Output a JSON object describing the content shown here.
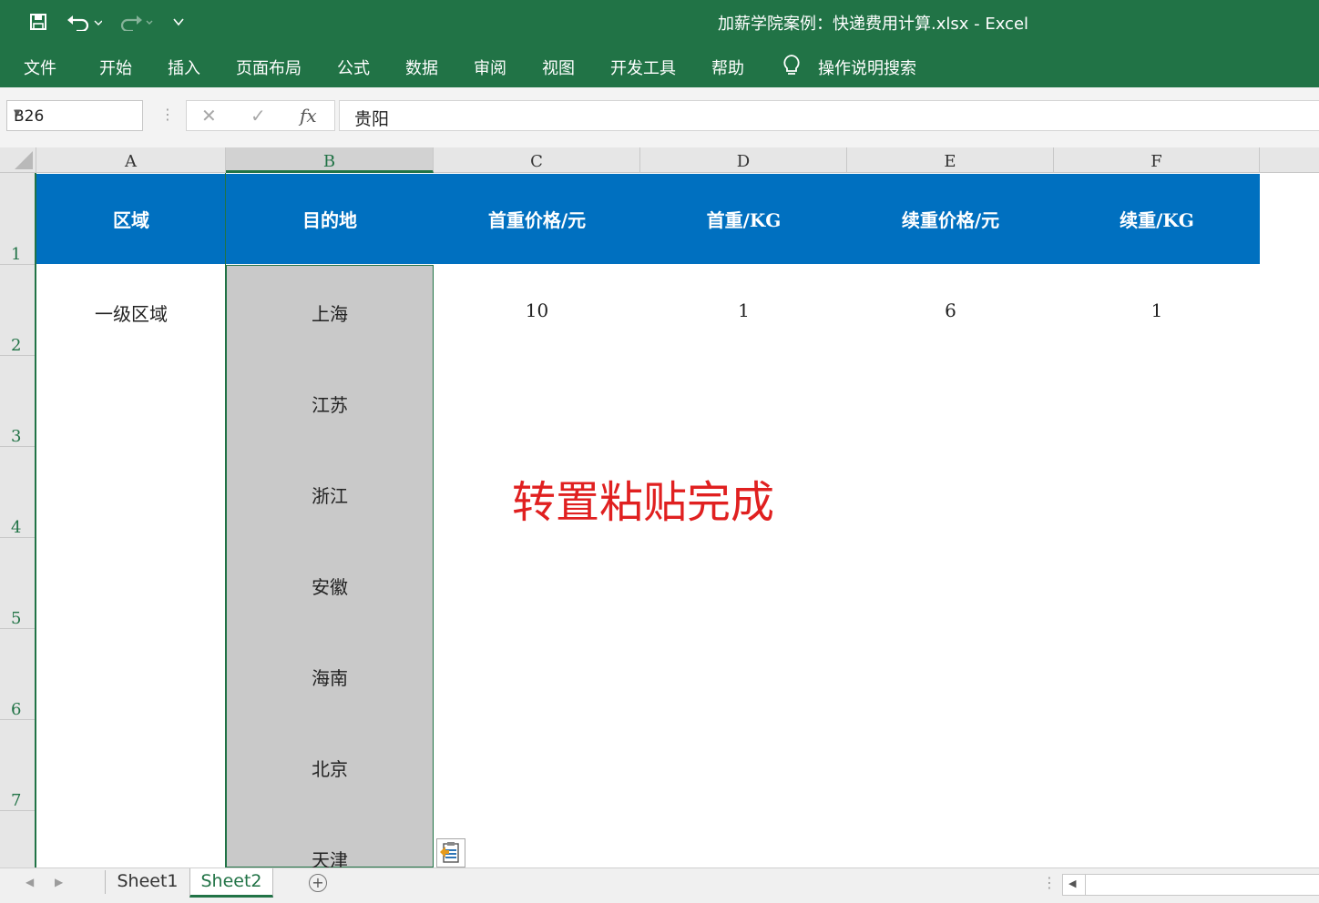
{
  "window": {
    "title": "加薪学院案例：快递费用计算.xlsx  -  Excel"
  },
  "quick_access": {
    "save_icon": "save-icon",
    "undo_icon": "undo-icon",
    "redo_icon": "redo-icon",
    "customize_icon": "customize-icon"
  },
  "ribbon": {
    "tabs": [
      "文件",
      "开始",
      "插入",
      "页面布局",
      "公式",
      "数据",
      "审阅",
      "视图",
      "开发工具",
      "帮助"
    ],
    "tell_me": "操作说明搜索"
  },
  "formula_bar": {
    "name_box": "B26",
    "fx": "fx",
    "value": "贵阳"
  },
  "columns": [
    "A",
    "B",
    "C",
    "D",
    "E",
    "F"
  ],
  "rows": [
    "1",
    "2",
    "3",
    "4",
    "5",
    "6",
    "7"
  ],
  "header_row": [
    "区域",
    "目的地",
    "首重价格/元",
    "首重/KG",
    "续重价格/元",
    "续重/KG"
  ],
  "data": {
    "region": "一级区域",
    "first_price": "10",
    "first_weight": "1",
    "next_price": "6",
    "next_weight": "1",
    "destinations": [
      "上海",
      "江苏",
      "浙江",
      "安徽",
      "海南",
      "北京",
      "天津"
    ]
  },
  "annotation": "转置粘贴完成",
  "sheets": [
    "Sheet1",
    "Sheet2"
  ],
  "active_sheet": "Sheet2",
  "colors": {
    "excel_green": "#217346",
    "header_blue": "#0070c0",
    "annotation_red": "#e02020",
    "selection_gray": "#c9c9c9"
  }
}
